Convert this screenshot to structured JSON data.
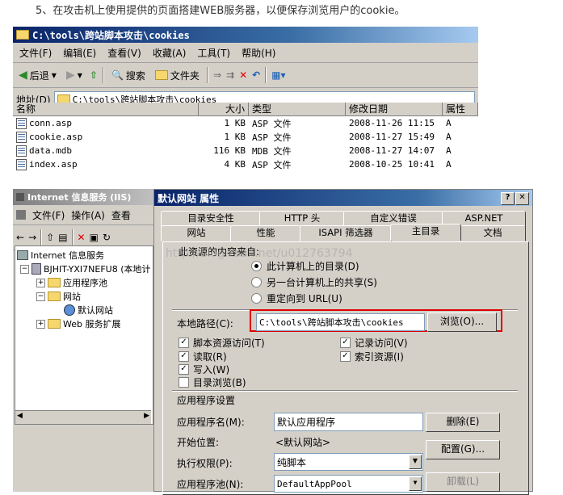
{
  "intro": "5、在攻击机上使用提供的页面搭建WEB服务器，以便保存浏览用户的cookie。",
  "explorer": {
    "title": "C:\\tools\\跨站脚本攻击\\cookies",
    "menu": [
      "文件(F)",
      "编辑(E)",
      "查看(V)",
      "收藏(A)",
      "工具(T)",
      "帮助(H)"
    ],
    "toolbar": {
      "back": "后退",
      "search": "搜索",
      "folders": "文件夹"
    },
    "address_label": "地址(D)",
    "address_value": "C:\\tools\\跨站脚本攻击\\cookies",
    "columns": [
      "名称",
      "大小",
      "类型",
      "修改日期",
      "属性"
    ],
    "files": [
      {
        "name": "conn.asp",
        "size": "1 KB",
        "type": "ASP 文件",
        "date": "2008-11-26 11:15",
        "attr": "A"
      },
      {
        "name": "cookie.asp",
        "size": "1 KB",
        "type": "ASP 文件",
        "date": "2008-11-27 15:49",
        "attr": "A"
      },
      {
        "name": "data.mdb",
        "size": "116 KB",
        "type": "MDB 文件",
        "date": "2008-11-27 14:07",
        "attr": "A"
      },
      {
        "name": "index.asp",
        "size": "4 KB",
        "type": "ASP 文件",
        "date": "2008-10-25 10:41",
        "attr": "A"
      }
    ]
  },
  "iis": {
    "title": "Internet 信息服务 (IIS)",
    "menu": [
      "文件(F)",
      "操作(A)",
      "查看"
    ],
    "tree": {
      "root": "Internet 信息服务",
      "server": "BJHIT-YXI7NEFU8 (本地计",
      "app_pools": "应用程序池",
      "websites": "网站",
      "default_site": "默认网站",
      "web_ext": "Web 服务扩展"
    }
  },
  "dialog": {
    "title": "默认网站 属性",
    "tabs_row1": [
      "目录安全性",
      "HTTP 头",
      "自定义错误",
      "ASP.NET"
    ],
    "tabs_row2": [
      "网站",
      "性能",
      "ISAPI 筛选器",
      "主目录",
      "文档"
    ],
    "source_label": "此资源的内容来自:",
    "source_options": [
      "此计算机上的目录(D)",
      "另一台计算机上的共享(S)",
      "重定向到 URL(U)"
    ],
    "local_path_label": "本地路径(C):",
    "local_path_value": "C:\\tools\\跨站脚本攻击\\cookies",
    "browse_button": "浏览(O)...",
    "checks_left": [
      "脚本资源访问(T)",
      "读取(R)",
      "写入(W)",
      "目录浏览(B)"
    ],
    "checks_left_state": [
      true,
      true,
      true,
      false
    ],
    "checks_right": [
      "记录访问(V)",
      "索引资源(I)"
    ],
    "checks_right_state": [
      true,
      true
    ],
    "app_settings_label": "应用程序设置",
    "app_name_label": "应用程序名(M):",
    "app_name_value": "默认应用程序",
    "remove_button": "删除(E)",
    "start_label": "开始位置:",
    "start_value": "<默认网站>",
    "config_button": "配置(G)...",
    "exec_label": "执行权限(P):",
    "exec_value": "纯脚本",
    "pool_label": "应用程序池(N):",
    "pool_value": "DefaultAppPool",
    "unload_button": "卸载(L)"
  },
  "watermark": "http://blog.csdn.net/u012763794",
  "colors": {
    "title_active": "#0a246a",
    "highlight_box": "#e00000",
    "dialog_bg": "#d4d0c8"
  }
}
